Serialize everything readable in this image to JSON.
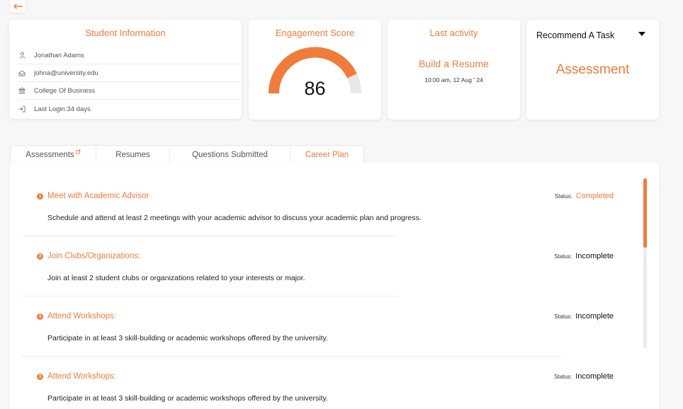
{
  "student": {
    "title": "Student Information",
    "name": "Jonathan Adams",
    "email": "johna@university.edu",
    "college": "College Of Business",
    "last_login": "Last Login:34 days"
  },
  "engagement": {
    "title": "Engagement Score",
    "score": "86",
    "score_fraction": 0.86
  },
  "last_activity": {
    "title": "Last activity",
    "activity": "Build a Resume",
    "time": "10:00 am, 12 Aug ' 24"
  },
  "recommend": {
    "title": "Recommend A Task",
    "selected": "Assessment"
  },
  "tabs": [
    {
      "label": "Assessments"
    },
    {
      "label": "Resumes"
    },
    {
      "label": "Questions Submitted"
    },
    {
      "label": "Career Plan"
    }
  ],
  "status_label": "Status:",
  "tasks": [
    {
      "num": "1",
      "title": "Meet with Academic Advisor",
      "desc": "Schedule and attend at least 2 meetings with your academic advisor to discuss your academic plan and progress.",
      "status": "Completed"
    },
    {
      "num": "2",
      "title": "Join Clubs/Organizations:",
      "desc": "Join at least 2 student clubs or organizations related to your interests or major.",
      "status": "Incomplete"
    },
    {
      "num": "3",
      "title": "Attend Workshops:",
      "desc": "Participate in at least 3 skill-building or academic workshops offered by the university.",
      "status": "Incomplete"
    },
    {
      "num": "3",
      "title": "Attend Workshops:",
      "desc": "Participate in at least 3 skill-building or academic workshops offered by the university.",
      "status": "Incomplete"
    }
  ],
  "colors": {
    "accent": "#f07c3c",
    "gauge_track": "#e8e8e8"
  }
}
